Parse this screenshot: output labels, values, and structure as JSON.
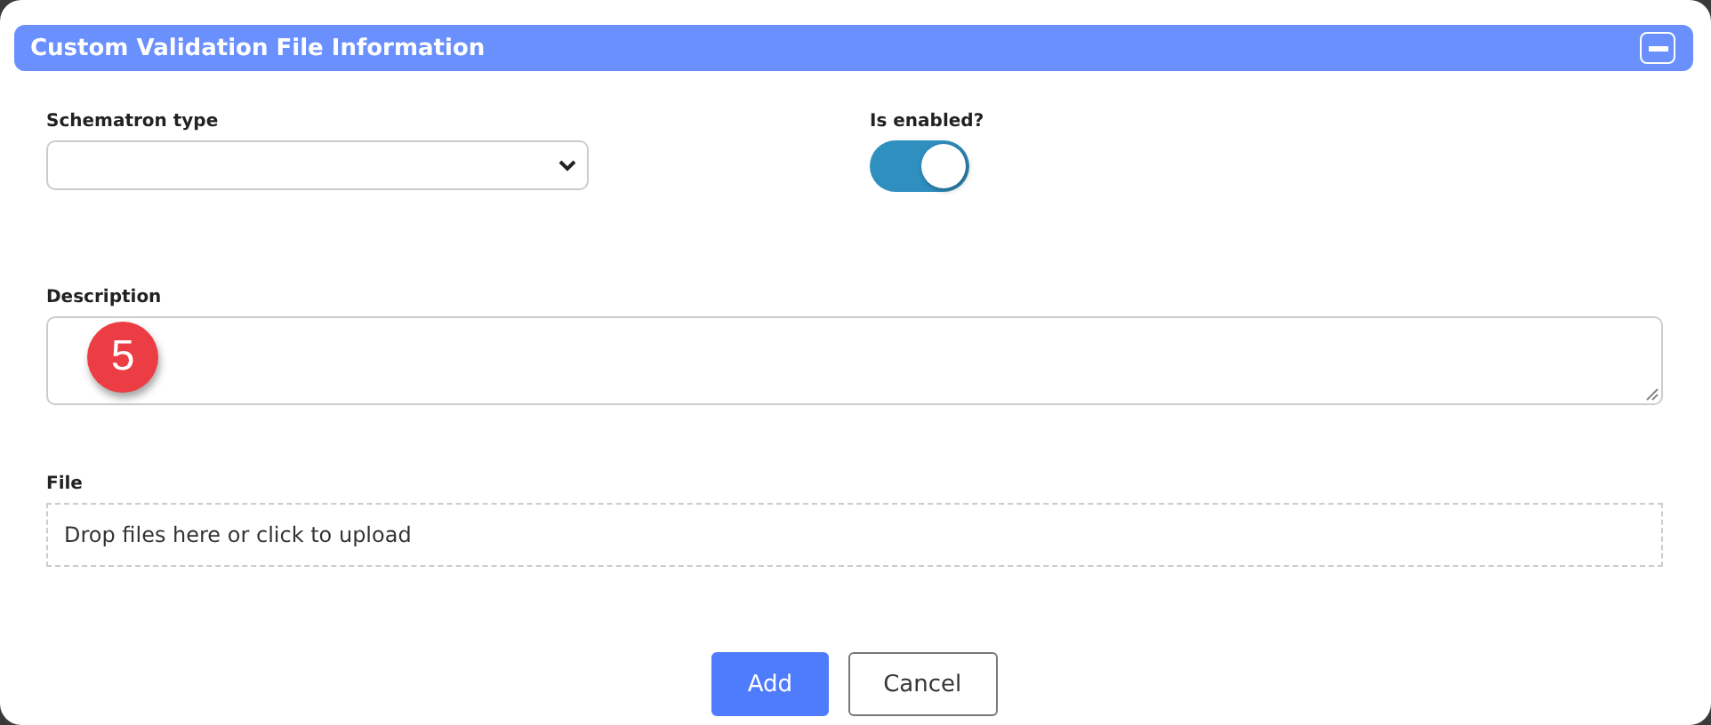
{
  "panel": {
    "title": "Custom Validation File Information"
  },
  "fields": {
    "schematron_type": {
      "label": "Schematron type"
    },
    "is_enabled": {
      "label": "Is enabled?",
      "on": true
    },
    "description": {
      "label": "Description"
    },
    "file": {
      "label": "File",
      "dropzone_text": "Drop files here or click to upload"
    }
  },
  "step_badge": "5",
  "buttons": [
    {
      "label": "Add",
      "kind": "primary"
    },
    {
      "label": "Cancel",
      "kind": "secondary"
    }
  ]
}
